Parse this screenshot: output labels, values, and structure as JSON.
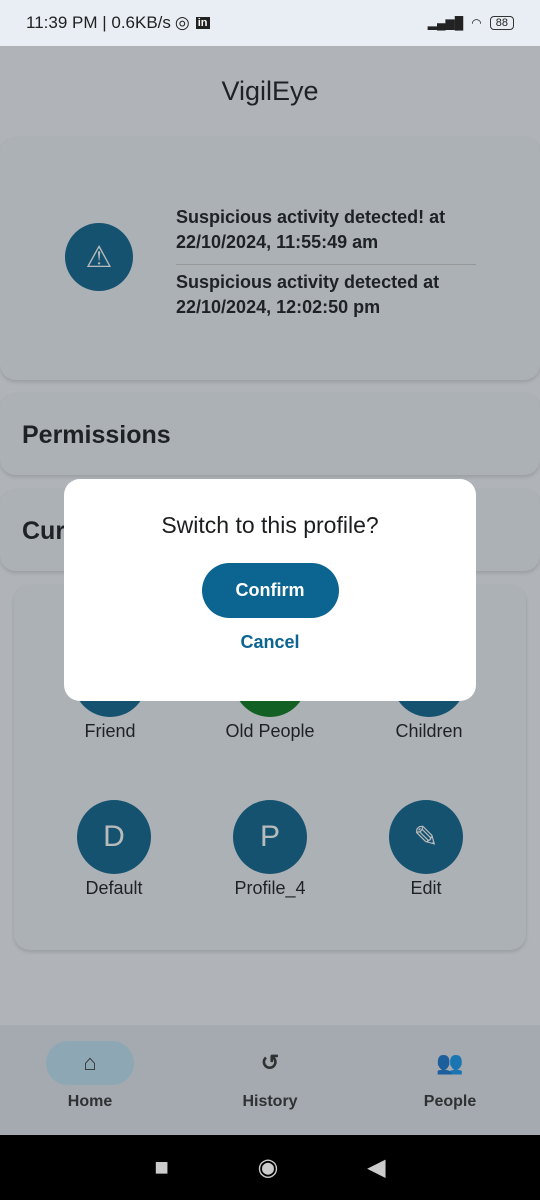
{
  "status": {
    "time": "11:39 PM | 0.6KB/s",
    "battery": "88"
  },
  "app": {
    "title": "VigilEye"
  },
  "alerts": [
    "Suspicious activity detected! at 22/10/2024, 11:55:49 am",
    "Suspicious activity detected at 22/10/2024, 12:02:50 pm"
  ],
  "sections": {
    "permissions": "Permissions",
    "current": "Cur"
  },
  "profiles": [
    {
      "label": "Friend",
      "color": "#0b6590"
    },
    {
      "label": "Old People",
      "color": "#0a7a1f"
    },
    {
      "label": "Children",
      "color": "#0b6590"
    },
    {
      "label": "Default",
      "initial": "D"
    },
    {
      "label": "Profile_4",
      "initial": "P"
    },
    {
      "label": "Edit"
    }
  ],
  "nav": {
    "home": "Home",
    "history": "History",
    "people": "People"
  },
  "dialog": {
    "title": "Switch to this profile?",
    "confirm": "Confirm",
    "cancel": "Cancel"
  }
}
